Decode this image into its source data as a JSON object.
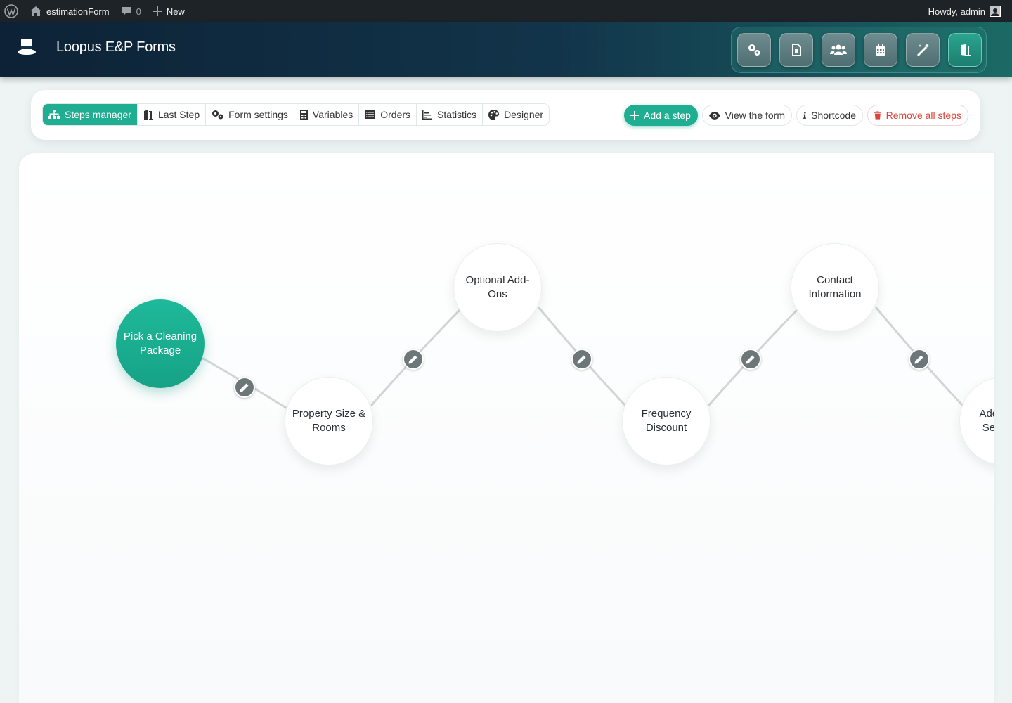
{
  "admin_bar": {
    "site_name": "estimationForm",
    "comments_count": "0",
    "new_label": "New",
    "greeting": "Howdy, admin"
  },
  "header": {
    "title": "Loopus E&P Forms",
    "tools": [
      "settings-gears-icon",
      "document-icon",
      "users-icon",
      "calendar-icon",
      "magic-wand-icon",
      "door-exit-icon"
    ]
  },
  "toolbar": {
    "tabs": [
      {
        "label": "Steps manager",
        "icon": "sitemap-icon",
        "active": true
      },
      {
        "label": "Last Step",
        "icon": "door-icon"
      },
      {
        "label": "Form settings",
        "icon": "gears-icon"
      },
      {
        "label": "Variables",
        "icon": "calculator-icon"
      },
      {
        "label": "Orders",
        "icon": "list-icon"
      },
      {
        "label": "Statistics",
        "icon": "chart-icon"
      },
      {
        "label": "Designer",
        "icon": "palette-icon"
      }
    ],
    "add_step": "Add a step",
    "view_form": "View the form",
    "shortcode": "Shortcode",
    "remove_all": "Remove all steps"
  },
  "steps": [
    {
      "label": "Pick a Cleaning Package",
      "start": true
    },
    {
      "label": "Property Size & Rooms"
    },
    {
      "label": "Optional Add-Ons"
    },
    {
      "label": "Frequency Discount"
    },
    {
      "label": "Contact Information"
    },
    {
      "label": "Additional Services"
    }
  ],
  "colors": {
    "accent": "#1fae91",
    "danger": "#e0433b",
    "admin_bar": "#1d2327",
    "header_dark": "#0d2236",
    "header_teal": "#1b6a66"
  }
}
